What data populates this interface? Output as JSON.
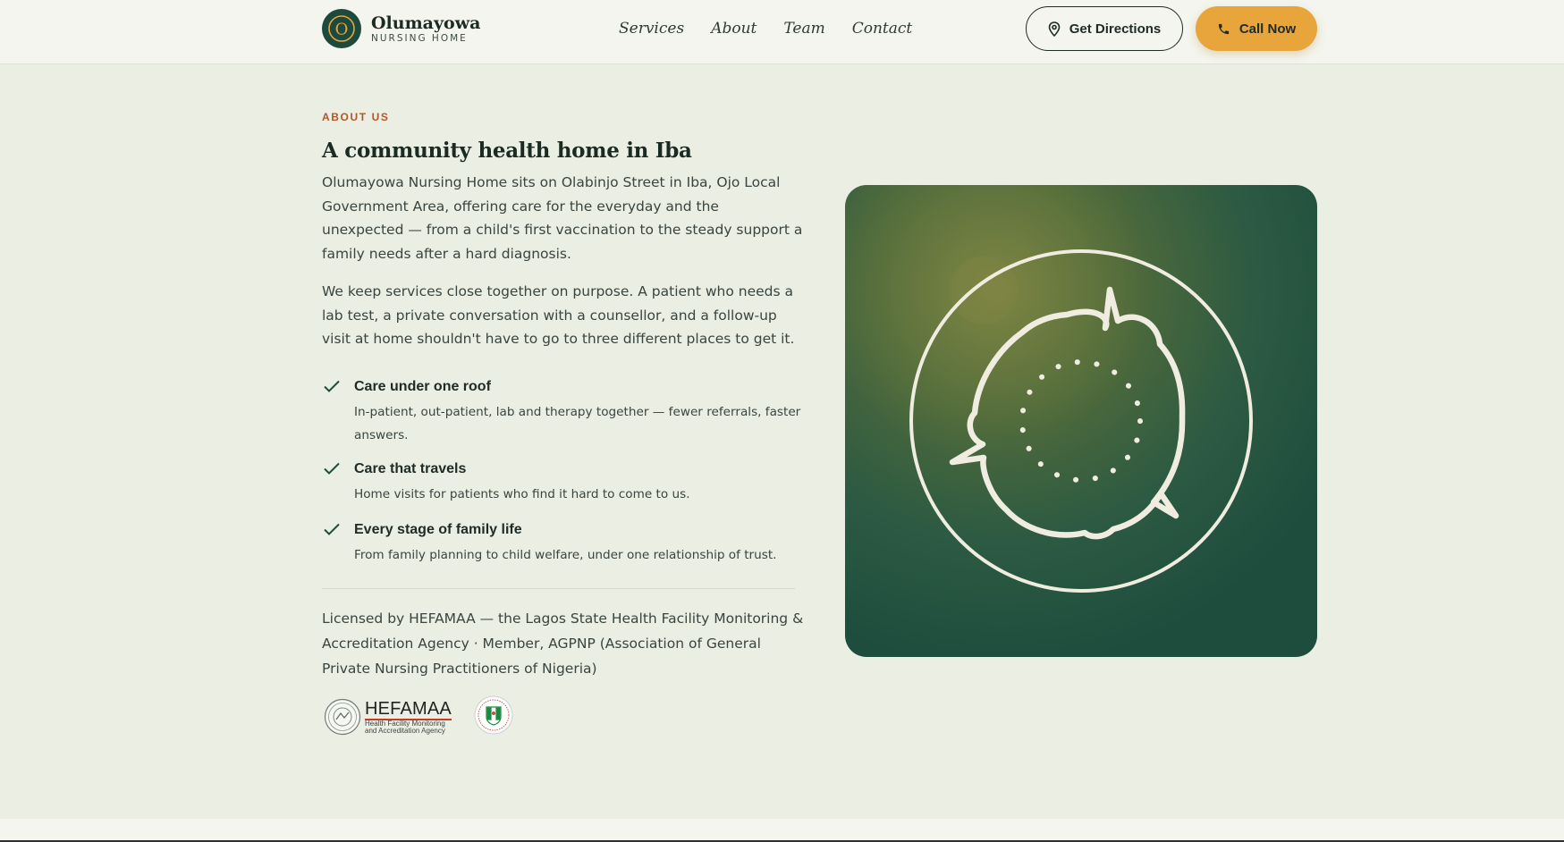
{
  "header": {
    "brand_name": "Olumayowa",
    "brand_sub": "NURSING HOME",
    "logo_letter": "O",
    "nav": [
      "Services",
      "About",
      "Team",
      "Contact"
    ],
    "directions_label": "Get Directions",
    "call_label": "Call Now"
  },
  "about": {
    "eyebrow": "ABOUT US",
    "heading": "A community health home in Iba",
    "paragraphs": [
      "Olumayowa Nursing Home sits on Olabinjo Street in Iba, Ojo Local Government Area, offering care for the everyday and the unexpected — from a child's first vaccination to the steady support a family needs after a hard diagnosis.",
      "We keep services close together on purpose. A patient who needs a lab test, a private conversation with a counsellor, and a follow-up visit at home shouldn't have to go to three different places to get it."
    ],
    "features": [
      {
        "title": "Care under one roof",
        "desc": "In-patient, out-patient, lab and therapy together — fewer referrals, faster answers."
      },
      {
        "title": "Care that travels",
        "desc": "Home visits for patients who find it hard to come to us."
      },
      {
        "title": "Every stage of family life",
        "desc": "From family planning to child welfare, under one relationship of trust."
      }
    ],
    "license": "Licensed by HEFAMAA — the Lagos State Health Facility Monitoring & Accreditation Agency · Member, AGPNP (Association of General Private Nursing Practitioners of Nigeria)",
    "hefamaa_title": "HEFAMAA",
    "hefamaa_sub": "Health Facility Monitoring and Accreditation Agency"
  },
  "colors": {
    "accent": "#e7a53c",
    "brand_green": "#1d4a3c",
    "eyebrow": "#b4552a",
    "page_bg": "#eaeee3"
  },
  "icons": [
    "map-pin-icon",
    "phone-icon",
    "check-icon",
    "community-care-illustration"
  ]
}
